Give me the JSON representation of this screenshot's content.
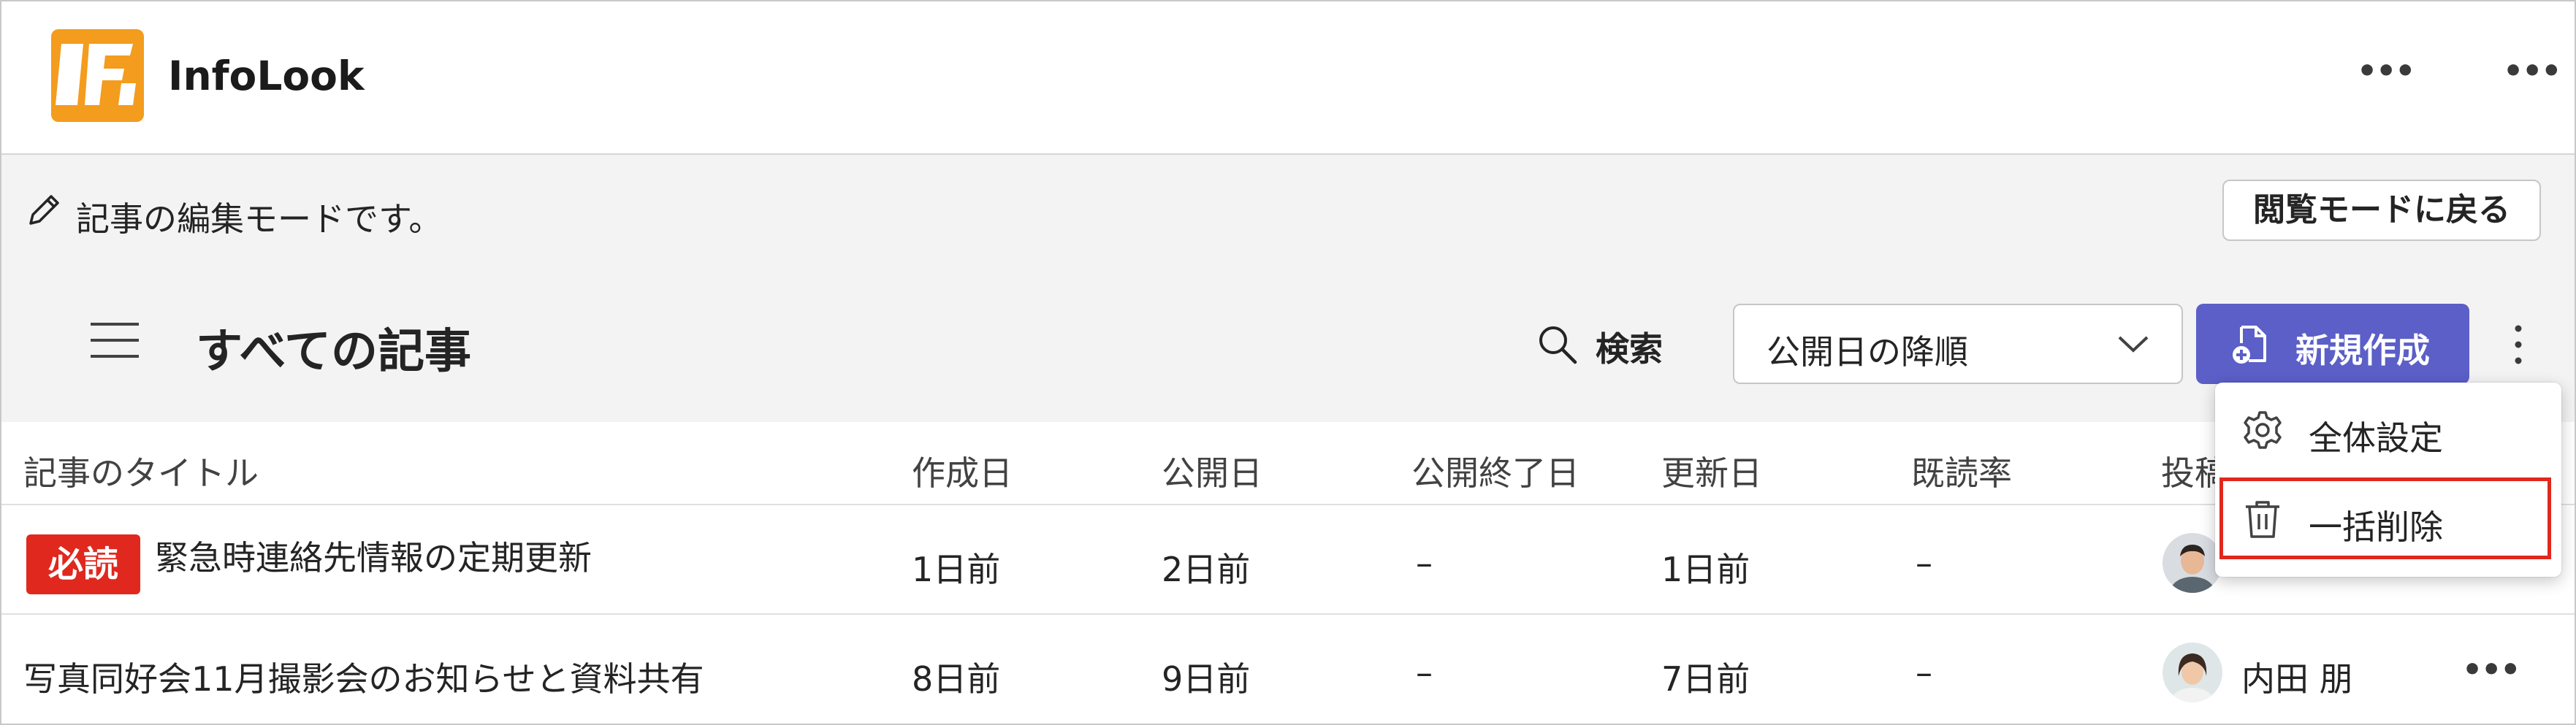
{
  "app": {
    "title": "InfoLook",
    "logo_icon": "infolook-logo",
    "brand_color": "#f39c1e"
  },
  "header": {
    "more_icon_1": "more-horizontal-icon",
    "more_icon_2": "more-horizontal-icon"
  },
  "mode_bar": {
    "text": "記事の編集モードです。",
    "back_label": "閲覧モードに戻る"
  },
  "toolbar": {
    "title": "すべての記事",
    "search_label": "検索",
    "sort_value": "公開日の降順",
    "new_label": "新規作成",
    "accent": "#5b5fc7"
  },
  "table": {
    "columns": [
      "記事のタイトル",
      "作成日",
      "公開日",
      "公開終了日",
      "更新日",
      "既読率",
      "投稿"
    ],
    "rows": [
      {
        "badge": "必読",
        "title": "緊急時連絡先情報の定期更新",
        "created": "1日前",
        "published": "2日前",
        "end": "–",
        "updated": "1日前",
        "read_rate": "–",
        "author": ""
      },
      {
        "badge": "",
        "title": "写真同好会11月撮影会のお知らせと資料共有",
        "created": "8日前",
        "published": "9日前",
        "end": "–",
        "updated": "7日前",
        "read_rate": "–",
        "author": "内田 朋"
      }
    ],
    "badge_color": "#e0281e"
  },
  "menu": {
    "items": [
      {
        "label": "全体設定",
        "icon": "gear-icon"
      },
      {
        "label": "一括削除",
        "icon": "trash-icon"
      }
    ]
  }
}
